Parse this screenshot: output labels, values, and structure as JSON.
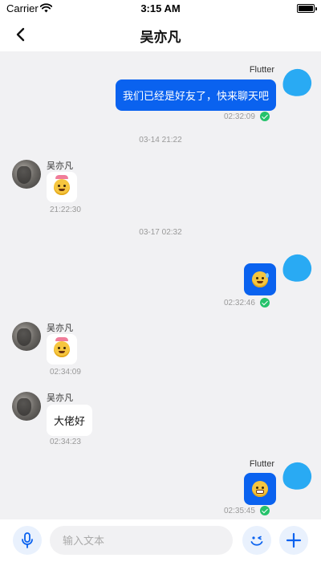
{
  "status_bar": {
    "carrier": "Carrier",
    "time": "3:15 AM"
  },
  "header": {
    "title": "吴亦凡"
  },
  "messages": [
    {
      "kind": "outgoing",
      "sender": "Flutter",
      "text": "我们已经是好友了，快来聊天吧",
      "time": "02:32:09"
    },
    {
      "kind": "timestamp",
      "text": "03-14 21:22"
    },
    {
      "kind": "incoming",
      "sender": "吴亦凡",
      "sticker": "party-face-emoji",
      "time": "21:22:30"
    },
    {
      "kind": "timestamp",
      "text": "03-17 02:32"
    },
    {
      "kind": "outgoing",
      "sender": "",
      "sticker": "worried-face-emoji",
      "time": "02:32:46"
    },
    {
      "kind": "incoming",
      "sender": "吴亦凡",
      "sticker": "party-face-emoji",
      "time": "02:34:09"
    },
    {
      "kind": "incoming",
      "sender": "吴亦凡",
      "text": "大佬好",
      "time": "02:34:23"
    },
    {
      "kind": "outgoing",
      "sender": "Flutter",
      "sticker": "grimacing-face-emoji",
      "time": "02:35:45"
    }
  ],
  "composer": {
    "placeholder": "输入文本"
  },
  "colors": {
    "accent": "#0a62ef",
    "avatar_blob": "#29aaf3",
    "read_check": "#25c26b",
    "chat_bg": "#f1f1f3"
  },
  "icons": [
    "wifi-icon",
    "battery-icon",
    "back-arrow-icon",
    "microphone-icon",
    "emoji-wink-icon",
    "plus-icon",
    "read-check-icon"
  ]
}
